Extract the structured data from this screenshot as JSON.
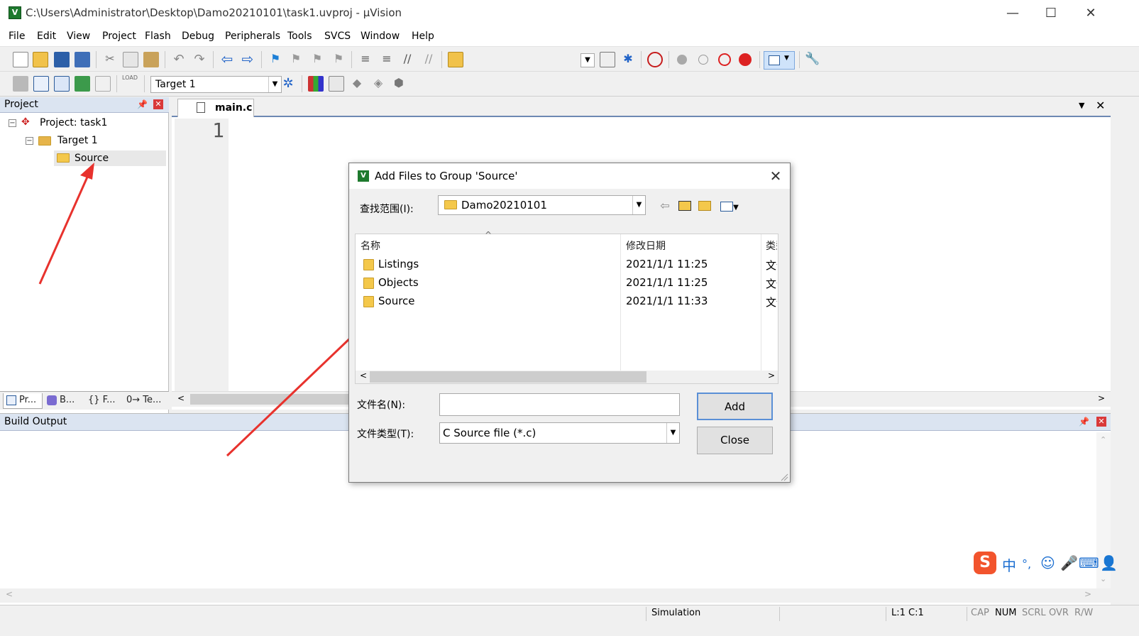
{
  "window": {
    "title": "C:\\Users\\Administrator\\Desktop\\Damo20210101\\task1.uvproj - µVision",
    "minimize": "—",
    "maximize": "☐",
    "close": "✕"
  },
  "menu": [
    "File",
    "Edit",
    "View",
    "Project",
    "Flash",
    "Debug",
    "Peripherals",
    "Tools",
    "SVCS",
    "Window",
    "Help"
  ],
  "toolbar": {
    "target_value": "Target 1"
  },
  "project_pane": {
    "title": "Project",
    "tree": {
      "project": "Project: task1",
      "target": "Target 1",
      "group": "Source"
    },
    "tabs": [
      "Pr...",
      "B...",
      "{} F...",
      "0→ Te..."
    ]
  },
  "editor": {
    "tab": "main.c",
    "line_number": "1"
  },
  "build_output": {
    "title": "Build Output"
  },
  "statusbar": {
    "mode": "Simulation",
    "position": "L:1 C:1",
    "indicators": [
      "CAP",
      "NUM",
      "SCRL",
      "OVR",
      "R/W"
    ]
  },
  "dialog": {
    "title": "Add Files to Group 'Source'",
    "lookin_label": "查找范围(I):",
    "lookin_value": "Damo20210101",
    "columns": {
      "name": "名称",
      "date": "修改日期",
      "type": "类型"
    },
    "files": [
      {
        "name": "Listings",
        "date": "2021/1/1 11:25",
        "type": "文件夹"
      },
      {
        "name": "Objects",
        "date": "2021/1/1 11:25",
        "type": "文件夹"
      },
      {
        "name": "Source",
        "date": "2021/1/1 11:33",
        "type": "文件夹"
      }
    ],
    "filename_label": "文件名(N):",
    "filename_value": "",
    "filetype_label": "文件类型(T):",
    "filetype_value": "C Source file (*.c)",
    "add_button": "Add",
    "close_button": "Close"
  },
  "ime": {
    "logo": "S",
    "lang": "中",
    "punct": "°,"
  },
  "colors": {
    "pane_header": "#dbe4f1",
    "annotation_arrow": "#e8322d",
    "accent_blue": "#1c6fd1"
  }
}
